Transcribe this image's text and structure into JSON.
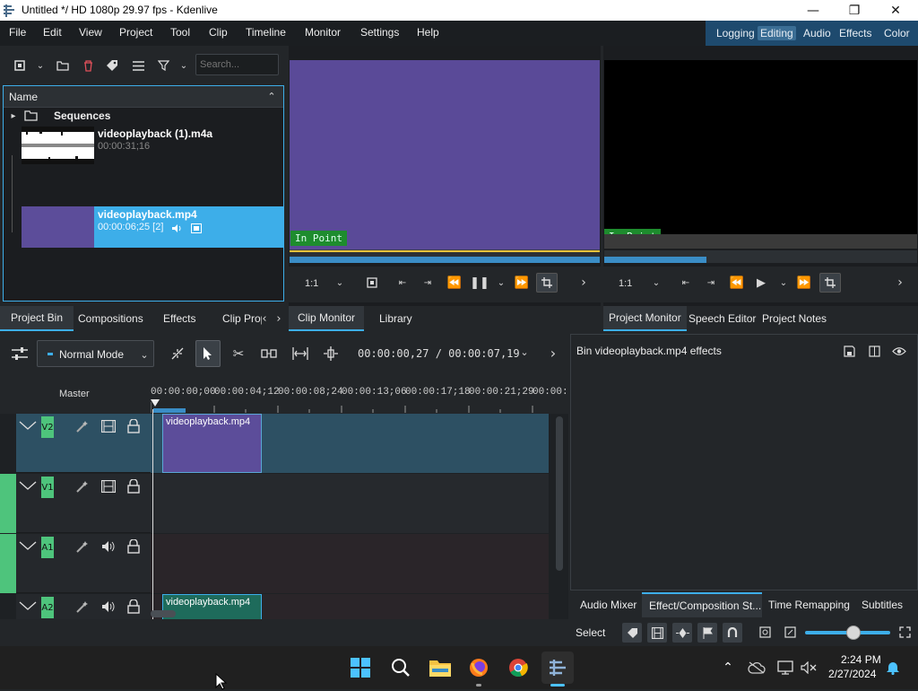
{
  "window": {
    "title": "Untitled */ HD 1080p 29.97 fps - Kdenlive"
  },
  "menu": [
    "File",
    "Edit",
    "View",
    "Project",
    "Tool",
    "Clip",
    "Timeline",
    "Monitor",
    "Settings",
    "Help"
  ],
  "layouts": {
    "items": [
      "Logging",
      "Editing",
      "Audio",
      "Effects",
      "Color"
    ],
    "active": "Editing"
  },
  "bin": {
    "search_placeholder": "Search...",
    "header": "Name",
    "folder": "Sequences",
    "items": [
      {
        "name": "videoplayback (1).m4a",
        "duration": "00:00:31;16"
      },
      {
        "name": "videoplayback.mp4",
        "duration": "00:00:06;25 [2]"
      }
    ]
  },
  "clip_monitor": {
    "in_point": "In Point",
    "zoom": "1:1"
  },
  "project_monitor": {
    "in_point": "In Point",
    "zoom": "1:1"
  },
  "left_tabs": [
    "Project Bin",
    "Compositions",
    "Effects",
    "Clip Prop"
  ],
  "mid_tabs": [
    "Clip Monitor",
    "Library"
  ],
  "right_tabs": [
    "Project Monitor",
    "Speech Editor",
    "Project Notes"
  ],
  "timeline": {
    "mode": "Normal Mode",
    "timecode": "00:00:00,27 / 00:00:07,19",
    "master": "Master",
    "ruler": [
      "00:00:00;00",
      "00:00:04;12",
      "00:00:08;24",
      "00:00:13;06",
      "00:00:17;18",
      "00:00:21;29",
      "00:00:2"
    ],
    "tracks": [
      "V2",
      "V1",
      "A1",
      "A2"
    ],
    "clips": {
      "v2": "videoplayback.mp4",
      "a2": "videoplayback.mp4"
    }
  },
  "effects_panel": {
    "title": "Bin videoplayback.mp4 effects"
  },
  "bottom_tabs": [
    "Audio Mixer",
    "Effect/Composition St...",
    "Time Remapping",
    "Subtitles"
  ],
  "status": {
    "select": "Select"
  },
  "taskbar": {
    "time": "2:24 PM",
    "date": "2/27/2024"
  },
  "colors": {
    "accent": "#3daee9",
    "selection": "#3daee9",
    "track_green": "#4ec47c",
    "inpoint_green": "#1e8c2e"
  }
}
